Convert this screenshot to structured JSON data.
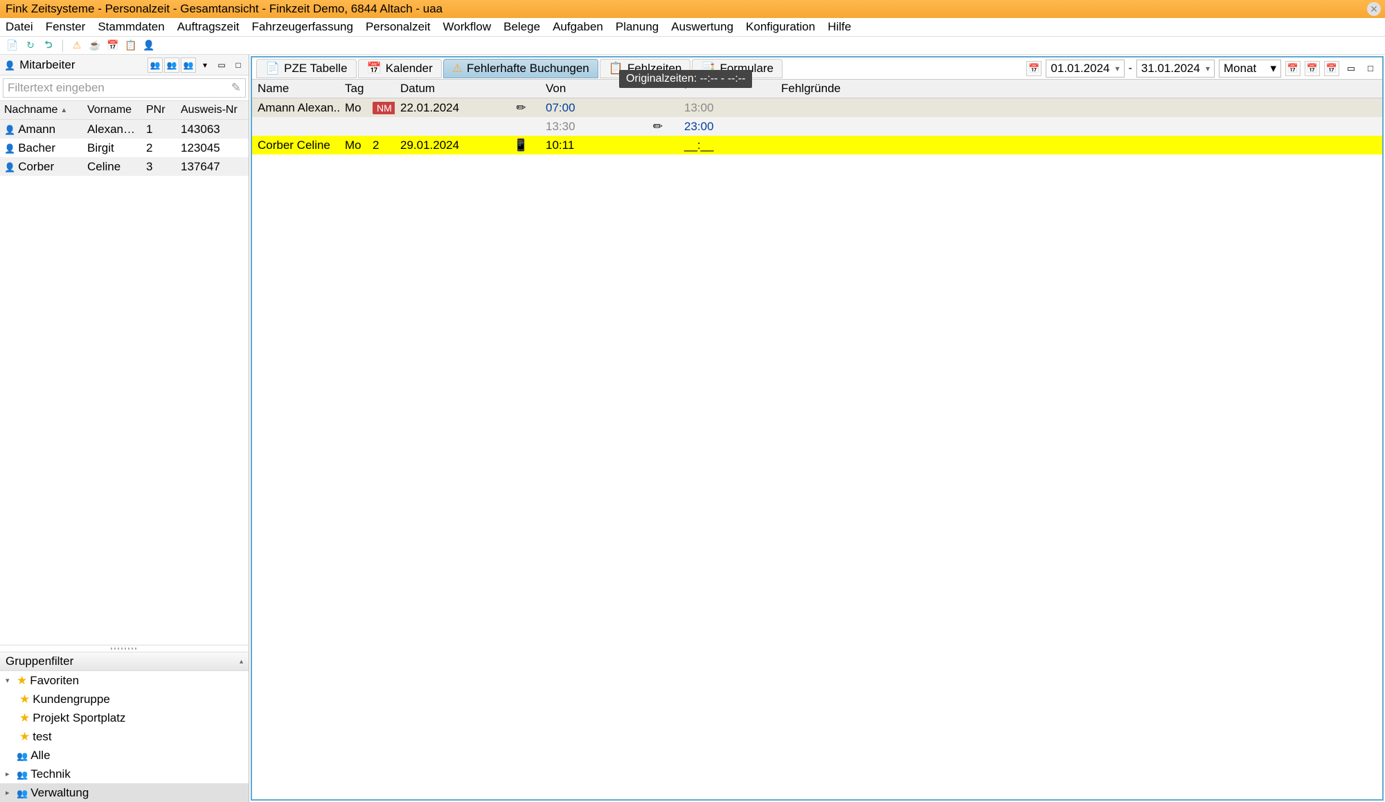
{
  "window": {
    "title": "Fink Zeitsysteme - Personalzeit - Gesamtansicht - Finkzeit Demo, 6844 Altach - uaa"
  },
  "menu": [
    "Datei",
    "Fenster",
    "Stammdaten",
    "Auftragszeit",
    "Fahrzeugerfassung",
    "Personalzeit",
    "Workflow",
    "Belege",
    "Aufgaben",
    "Planung",
    "Auswertung",
    "Konfiguration",
    "Hilfe"
  ],
  "sidebar": {
    "title": "Mitarbeiter",
    "filter_placeholder": "Filtertext eingeben",
    "columns": [
      "Nachname",
      "Vorname",
      "PNr",
      "Ausweis-Nr"
    ],
    "rows": [
      {
        "nachname": "Amann",
        "vorname": "Alexandra",
        "pnr": "1",
        "ausweis": "143063"
      },
      {
        "nachname": "Bacher",
        "vorname": "Birgit",
        "pnr": "2",
        "ausweis": "123045"
      },
      {
        "nachname": "Corber",
        "vorname": "Celine",
        "pnr": "3",
        "ausweis": "137647"
      }
    ],
    "gruppenfilter": "Gruppenfilter",
    "tree": [
      {
        "label": "Favoriten",
        "level": 0,
        "star": true,
        "expand": "▾"
      },
      {
        "label": "Kundengruppe",
        "level": 1,
        "star": true
      },
      {
        "label": "Projekt Sportplatz",
        "level": 1,
        "star": true
      },
      {
        "label": "test",
        "level": 1,
        "star": true
      },
      {
        "label": "Alle",
        "level": 0,
        "people": true
      },
      {
        "label": "Technik",
        "level": 0,
        "people": true,
        "expand": "▸"
      },
      {
        "label": "Verwaltung",
        "level": 0,
        "people": true,
        "expand": "▸",
        "sel": true
      }
    ]
  },
  "tabs": [
    {
      "label": "PZE Tabelle",
      "icon": "📄"
    },
    {
      "label": "Kalender",
      "icon": "📅"
    },
    {
      "label": "Fehlerhafte Buchungen",
      "icon": "⚠",
      "active": true
    },
    {
      "label": "Fehlzeiten",
      "icon": "📋"
    },
    {
      "label": "Formulare",
      "icon": "📑"
    }
  ],
  "daterange": {
    "from": "01.01.2024",
    "dash": "-",
    "to": "31.01.2024",
    "period": "Monat"
  },
  "grid": {
    "headers": [
      "Name",
      "Tag",
      "",
      "Datum",
      "",
      "Von",
      "",
      "",
      "Fehlgründe"
    ],
    "rows": [
      {
        "name": "Amann Alexan...",
        "tag": "Mo",
        "badge": "NM",
        "datum": "22.01.2024",
        "ic": "✏",
        "von": "07:00",
        "von_cls": "time-blue",
        "bis": "13:00",
        "bis_cls": "time-gray",
        "cls": "row-gray1"
      },
      {
        "name": "",
        "tag": "",
        "badge": "",
        "datum": "",
        "ic": "",
        "von": "13:30",
        "von_cls": "time-gray",
        "ic2": "✏",
        "bis": "23:00",
        "bis_cls": "time-blue",
        "cls": "row-gray2"
      },
      {
        "name": "Corber Celine",
        "tag": "Mo",
        "badge": "2",
        "datum": "29.01.2024",
        "ic": "📱",
        "von": "10:11",
        "von_cls": "",
        "bis": "__:__",
        "bis_cls": "",
        "cls": "row-yellow"
      }
    ]
  },
  "tooltip": "Originalzeiten: --:-- - --:--"
}
